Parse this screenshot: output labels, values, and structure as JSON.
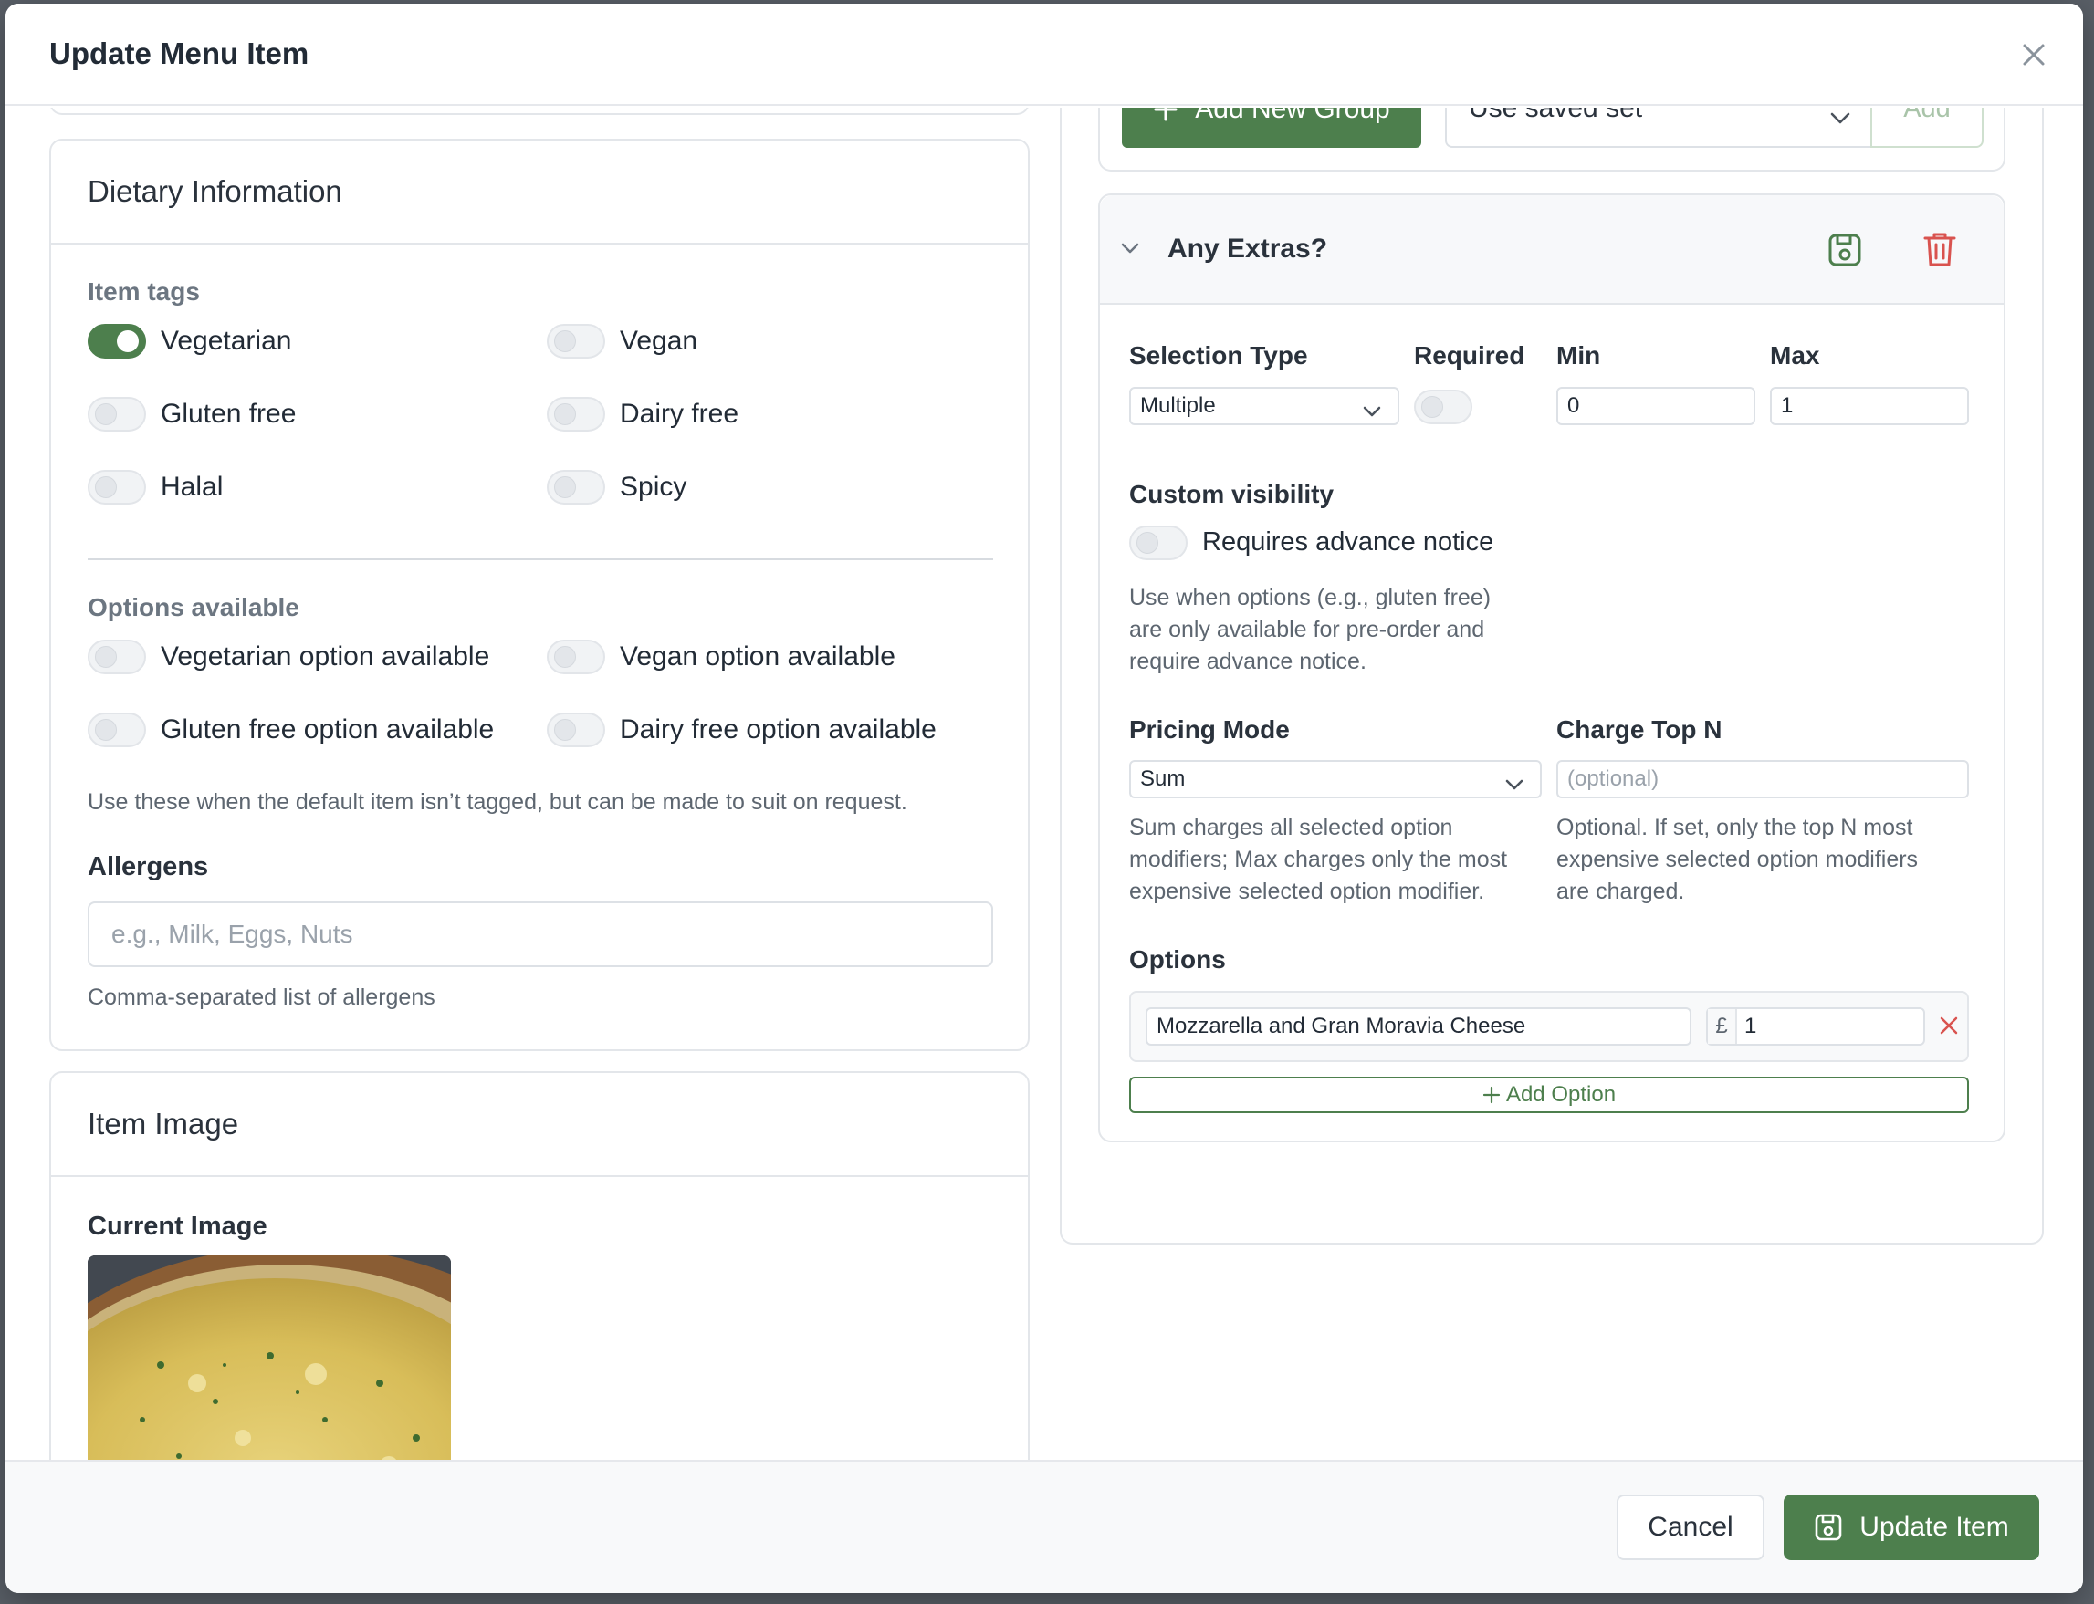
{
  "modal": {
    "title": "Update Menu Item"
  },
  "dietary": {
    "title": "Dietary Information",
    "item_tags_label": "Item tags",
    "tags": [
      {
        "label": "Vegetarian",
        "on": true
      },
      {
        "label": "Vegan",
        "on": false
      },
      {
        "label": "Gluten free",
        "on": false
      },
      {
        "label": "Dairy free",
        "on": false
      },
      {
        "label": "Halal",
        "on": false
      },
      {
        "label": "Spicy",
        "on": false
      }
    ],
    "options_label": "Options available",
    "options": [
      {
        "label": "Vegetarian option available",
        "on": false
      },
      {
        "label": "Vegan option available",
        "on": false
      },
      {
        "label": "Gluten free option available",
        "on": false
      },
      {
        "label": "Dairy free option available",
        "on": false
      }
    ],
    "options_help": "Use these when the default item isn’t tagged, but can be made to suit on request.",
    "allergens_label": "Allergens",
    "allergens_placeholder": "e.g., Milk, Eggs, Nuts",
    "allergens_help": "Comma-separated list of allergens"
  },
  "image_card": {
    "title": "Item Image",
    "current_label": "Current Image"
  },
  "groups": {
    "add_group_label": "Add New Group",
    "saved_set_value": "Use saved set",
    "add_label": "Add"
  },
  "extras": {
    "title": "Any Extras?",
    "selection_type_label": "Selection Type",
    "selection_type_value": "Multiple",
    "required_label": "Required",
    "required_on": false,
    "min_label": "Min",
    "min_value": "0",
    "max_label": "Max",
    "max_value": "1",
    "custom_visibility_label": "Custom visibility",
    "advance_notice_label": "Requires advance notice",
    "advance_notice_on": false,
    "visibility_help": [
      "Use when options (e.g., gluten free)",
      "are only available for pre-order and",
      "require advance notice."
    ],
    "pricing_mode_label": "Pricing Mode",
    "pricing_mode_value": "Sum",
    "charge_top_label": "Charge Top N",
    "charge_top_placeholder": "(optional)",
    "pricing_help": [
      "Sum charges all selected option",
      "modifiers; Max charges only the most",
      "expensive selected option modifier."
    ],
    "charge_help": [
      "Optional. If set, only the top N most",
      "expensive selected option modifiers",
      "are charged."
    ],
    "options_label": "Options",
    "option_name": "Mozzarella and Gran Moravia Cheese",
    "currency": "£",
    "option_price": "1",
    "add_option_label": "Add Option"
  },
  "footer": {
    "cancel_label": "Cancel",
    "update_label": "Update Item"
  },
  "colors": {
    "accent": "#4d7f4d",
    "danger": "#d9534f",
    "border": "#e3e6ea"
  }
}
